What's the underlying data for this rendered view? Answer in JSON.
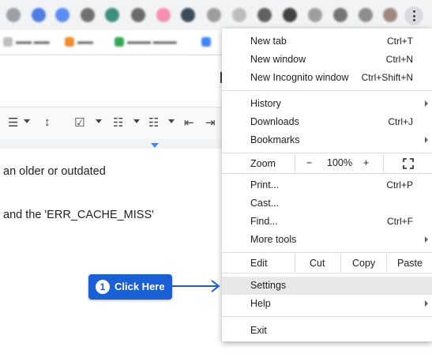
{
  "menu": {
    "new_tab": "New tab",
    "new_tab_shortcut": "Ctrl+T",
    "new_window": "New window",
    "new_window_shortcut": "Ctrl+N",
    "new_incognito": "New Incognito window",
    "new_incognito_shortcut": "Ctrl+Shift+N",
    "history": "History",
    "downloads": "Downloads",
    "downloads_shortcut": "Ctrl+J",
    "bookmarks": "Bookmarks",
    "zoom": "Zoom",
    "zoom_minus": "−",
    "zoom_value": "100%",
    "zoom_plus": "+",
    "print": "Print...",
    "print_shortcut": "Ctrl+P",
    "cast": "Cast...",
    "find": "Find...",
    "find_shortcut": "Ctrl+F",
    "more_tools": "More tools",
    "edit": "Edit",
    "cut": "Cut",
    "copy": "Copy",
    "paste": "Paste",
    "settings": "Settings",
    "help": "Help",
    "exit": "Exit"
  },
  "document": {
    "line1": "an older or outdated",
    "line2": "and the 'ERR_CACHE_MISS'"
  },
  "callout": {
    "number": "1",
    "label": "Click Here"
  },
  "colors": {
    "callout_blue": "#1a5fd6",
    "menu_highlight": "#e8e8e8"
  }
}
